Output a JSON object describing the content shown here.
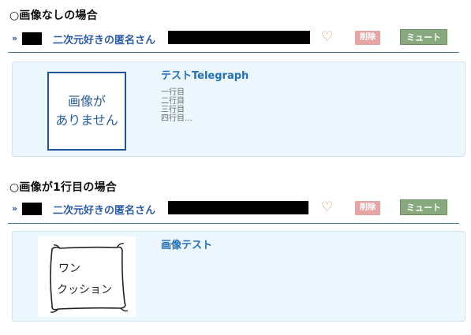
{
  "sections": [
    {
      "heading": "○画像なしの場合",
      "post": {
        "author": "二次元好きの匿名さん",
        "delete_label": "削除",
        "mute_label": "ミュート",
        "card": {
          "title": "テストTelegraph",
          "no_image_line1": "画像が",
          "no_image_line2": "ありません",
          "body_lines": [
            "一行目",
            "二行目",
            "三行目",
            "四行目…"
          ]
        }
      }
    },
    {
      "heading": "○画像が1行目の場合",
      "post": {
        "author": "二次元好きの匿名さん",
        "delete_label": "削除",
        "mute_label": "ミュート",
        "card": {
          "title": "画像テスト",
          "thumbnail_text_line1": "ワン",
          "thumbnail_text_line2": "クッション"
        }
      }
    }
  ],
  "colors": {
    "author": "#2a5aa8",
    "card_bg": "#ebf6fd",
    "card_title": "#2470bb",
    "delete_bg": "#e8a4a4",
    "mute_bg": "#87a97d",
    "heart": "#e48c6c"
  },
  "icons": {
    "reply": "double-chevron-right-icon",
    "favorite": "heart-outline-icon"
  }
}
